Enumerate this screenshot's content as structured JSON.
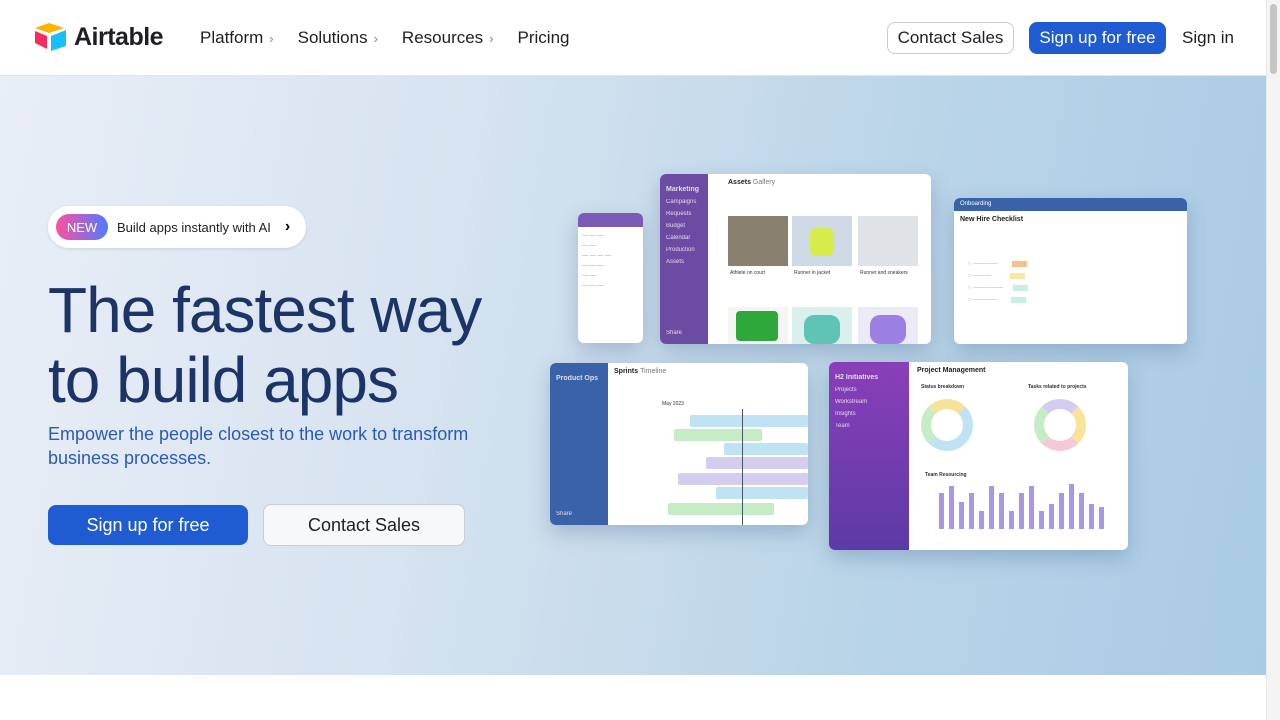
{
  "nav": {
    "brand": "Airtable",
    "items": [
      {
        "label": "Platform",
        "chevron": true
      },
      {
        "label": "Solutions",
        "chevron": true
      },
      {
        "label": "Resources",
        "chevron": true
      },
      {
        "label": "Pricing",
        "chevron": false
      }
    ],
    "contact_sales": "Contact Sales",
    "sign_up": "Sign up for free",
    "sign_in": "Sign in"
  },
  "hero": {
    "badge": "NEW",
    "announcement": "Build apps instantly with AI",
    "title_line1": "The fastest way",
    "title_line2": "to build apps",
    "subtitle": "Empower the people closest to the work to transform business processes.",
    "cta_primary": "Sign up for free",
    "cta_secondary": "Contact Sales"
  },
  "mockups": {
    "marketing": {
      "workspace": "Marketing",
      "view": "Assets",
      "view_type": "Gallery",
      "nav": [
        "Campaigns",
        "Requests",
        "Budget",
        "Calendar",
        "Production",
        "Assets"
      ],
      "cards": [
        "Athlete on court",
        "Runner in jacket",
        "Runner and sneakers"
      ],
      "share": "Share"
    },
    "onboarding": {
      "workspace": "Onboarding",
      "title": "New Hire Checklist"
    },
    "product_ops": {
      "workspace": "Product Ops",
      "view": "Sprints",
      "view_type": "Timeline",
      "month": "May 2023",
      "share": "Share"
    },
    "h2": {
      "workspace": "H2 Initiatives",
      "title": "Project Management",
      "nav": [
        "Projects",
        "Workstream",
        "Insights",
        "Team"
      ],
      "status": "Status breakdown",
      "tasks": "Tasks related to projects",
      "resourcing": "Team Resourcing"
    }
  },
  "colors": {
    "primary": "#1f5bd1",
    "heading": "#1c3466",
    "purple": "#6c4ba3",
    "blue": "#3a62a8"
  }
}
